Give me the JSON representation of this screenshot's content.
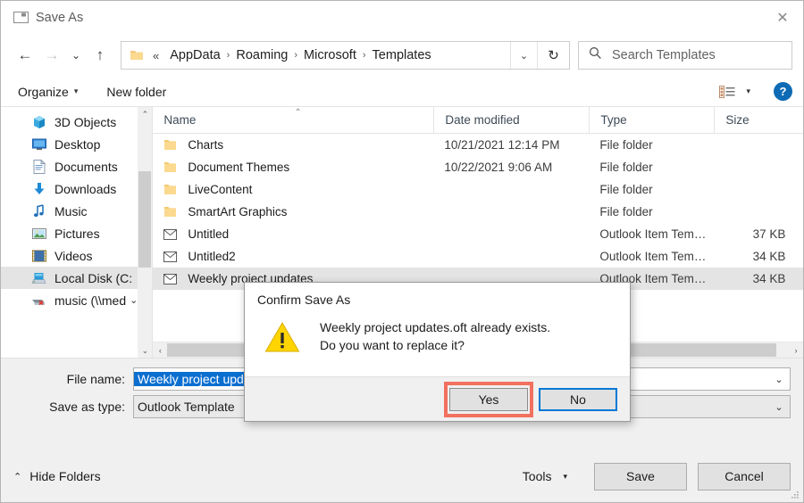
{
  "window": {
    "title": "Save As",
    "title_icon": "save-as-icon",
    "close_label": "✕"
  },
  "nav": {
    "back_icon": "arrow-left-icon",
    "forward_icon": "arrow-right-icon",
    "recent_icon": "chevron-down-icon",
    "up_icon": "arrow-up-icon",
    "address": {
      "folder_icon": "folder-icon",
      "ellipsis": "«",
      "crumbs": [
        "AppData",
        "Roaming",
        "Microsoft",
        "Templates"
      ],
      "separator": "›",
      "dropdown_icon": "chevron-down-icon",
      "refresh_icon": "refresh-icon"
    },
    "search": {
      "icon": "search-icon",
      "placeholder": "Search Templates",
      "value": ""
    }
  },
  "commandbar": {
    "organize_label": "Organize",
    "organize_caret": "▾",
    "new_folder_label": "New folder",
    "view_icon": "view-layout-icon",
    "view_caret": "▾",
    "help_label": "?"
  },
  "sidebar": {
    "scroll_up_icon": "⌃",
    "scroll_down_icon": "⌄",
    "items": [
      {
        "label": "3D Objects",
        "icon": "3d-objects-icon",
        "selected": false,
        "expandable": false
      },
      {
        "label": "Desktop",
        "icon": "desktop-icon",
        "selected": false,
        "expandable": false
      },
      {
        "label": "Documents",
        "icon": "documents-icon",
        "selected": false,
        "expandable": false
      },
      {
        "label": "Downloads",
        "icon": "downloads-icon",
        "selected": false,
        "expandable": false
      },
      {
        "label": "Music",
        "icon": "music-icon",
        "selected": false,
        "expandable": false
      },
      {
        "label": "Pictures",
        "icon": "pictures-icon",
        "selected": false,
        "expandable": false
      },
      {
        "label": "Videos",
        "icon": "videos-icon",
        "selected": false,
        "expandable": false
      },
      {
        "label": "Local Disk (C:",
        "icon": "drive-icon",
        "selected": true,
        "expandable": false
      },
      {
        "label": "music (\\\\med",
        "icon": "network-drive-disconnected-icon",
        "selected": false,
        "expandable": true
      }
    ]
  },
  "filelist": {
    "columns": [
      "Name",
      "Date modified",
      "Type",
      "Size"
    ],
    "sort_caret": "⌃",
    "rows": [
      {
        "name": "Charts",
        "icon": "folder-icon",
        "date": "10/21/2021 12:14 PM",
        "type": "File folder",
        "size": "",
        "selected": false
      },
      {
        "name": "Document Themes",
        "icon": "folder-icon",
        "date": "10/22/2021 9:06 AM",
        "type": "File folder",
        "size": "",
        "selected": false
      },
      {
        "name": "LiveContent",
        "icon": "folder-icon",
        "date": "",
        "type": "File folder",
        "size": "",
        "selected": false
      },
      {
        "name": "SmartArt Graphics",
        "icon": "folder-icon",
        "date": "",
        "type": "File folder",
        "size": "",
        "selected": false
      },
      {
        "name": "Untitled",
        "icon": "envelope-icon",
        "date": "",
        "type": "Outlook Item Tem…",
        "size": "37 KB",
        "selected": false
      },
      {
        "name": "Untitled2",
        "icon": "envelope-icon",
        "date": "",
        "type": "Outlook Item Tem…",
        "size": "34 KB",
        "selected": false
      },
      {
        "name": "Weekly project updates",
        "icon": "envelope-icon",
        "date": "",
        "type": "Outlook Item Tem…",
        "size": "34 KB",
        "selected": true
      }
    ],
    "hscroll": {
      "left_icon": "‹",
      "right_icon": "›"
    }
  },
  "form": {
    "filename_label": "File name:",
    "filename_value": "Weekly project updates",
    "filename_caret": "⌄",
    "savetype_label": "Save as type:",
    "savetype_value": "Outlook Template",
    "savetype_caret": "⌄"
  },
  "footer": {
    "hide_folders_caret": "⌃",
    "hide_folders_label": "Hide Folders",
    "tools_label": "Tools",
    "tools_caret": "▾",
    "save_label": "Save",
    "cancel_label": "Cancel"
  },
  "dialog": {
    "title": "Confirm Save As",
    "icon": "warning-triangle-icon",
    "message_line1": "Weekly project updates.oft already exists.",
    "message_line2": "Do you want to replace it?",
    "yes_label": "Yes",
    "no_label": "No"
  },
  "colors": {
    "accent_blue": "#0078d7",
    "selection_blue": "#0c6fd0",
    "annotation_red": "#f2705f",
    "warning_yellow": "#ffd400",
    "help_blue": "#0d6bb5",
    "folder_yellow": "#f8cf6b",
    "row_selected": "#e4e4e4"
  }
}
